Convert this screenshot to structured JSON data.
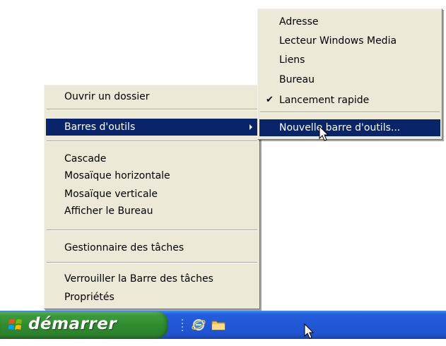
{
  "context_menu": {
    "items": [
      {
        "label": "Ouvrir un dossier"
      },
      {
        "label": "Barres d'outils"
      },
      {
        "label": "Cascade"
      },
      {
        "label": "Mosaïque horizontale"
      },
      {
        "label": "Mosaïque verticale"
      },
      {
        "label": "Afficher le Bureau"
      },
      {
        "label": "Gestionnaire des tâches"
      },
      {
        "label": "Verrouiller la Barre des tâches"
      },
      {
        "label": "Propriétés"
      }
    ]
  },
  "toolbars_submenu": {
    "items": [
      {
        "label": "Adresse"
      },
      {
        "label": "Lecteur Windows Media"
      },
      {
        "label": "Liens"
      },
      {
        "label": "Bureau"
      },
      {
        "label": "Lancement rapide",
        "checked": true
      },
      {
        "label": "Nouvelle barre d'outils..."
      }
    ],
    "check_glyph": "✔"
  },
  "taskbar": {
    "start_label": "démarrer",
    "quick_launch": [
      "internet-explorer-icon",
      "folder-icon"
    ]
  },
  "colors": {
    "menu_bg": "#ece9d8",
    "highlight": "#0a246a",
    "taskbar_blue": "#245edb",
    "start_green": "#3c9a3c"
  }
}
